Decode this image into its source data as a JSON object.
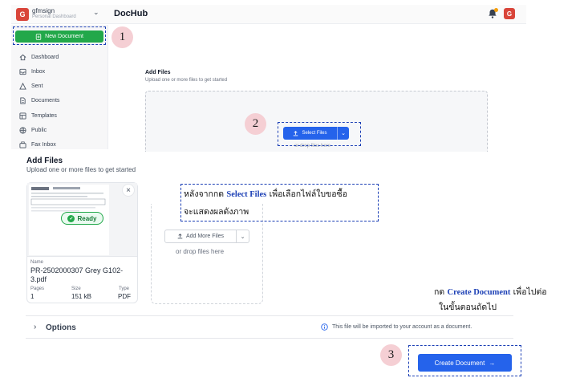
{
  "header": {
    "workspace_initial": "G",
    "workspace_name": "gfmsign",
    "workspace_subtitle": "Personal Dashboard",
    "app_title": "DocHub",
    "user_initial": "G"
  },
  "sidebar": {
    "new_document_label": "New Document",
    "items": [
      {
        "label": "Dashboard",
        "icon": "home-icon"
      },
      {
        "label": "Inbox",
        "icon": "inbox-icon"
      },
      {
        "label": "Sent",
        "icon": "send-icon"
      },
      {
        "label": "Documents",
        "icon": "document-icon"
      },
      {
        "label": "Templates",
        "icon": "template-icon"
      },
      {
        "label": "Public",
        "icon": "globe-icon"
      },
      {
        "label": "Fax Inbox",
        "icon": "fax-icon"
      }
    ]
  },
  "upload_top": {
    "title": "Add Files",
    "subtitle": "Upload one or more files to get started",
    "select_files_label": "Select Files",
    "drop_text": "or drop files here"
  },
  "upload_bottom": {
    "title": "Add Files",
    "subtitle": "Upload one or more files to get started",
    "file": {
      "status": "Ready",
      "name_label": "Name",
      "name": "PR-2502000307 Grey G102-3.pdf",
      "pages_label": "Pages",
      "pages": "1",
      "size_label": "Size",
      "size": "151 kB",
      "type_label": "Type",
      "type": "PDF"
    },
    "add_more_label": "Add More Files",
    "drop_text": "or drop files here",
    "options_label": "Options",
    "import_note": "This file will be imported to your account as a document.",
    "create_document_label": "Create Document"
  },
  "annotations": {
    "step1": "1",
    "step2": "2",
    "step3": "3",
    "note2_prefix": "หลังจากกด ",
    "note2_highlight": "Select Files",
    "note2_suffix": " เพื่อเลือกไฟล์ใบขอซื้อ",
    "note2_line2": "จะแสดงผลดังภาพ",
    "note3_prefix": "กด ",
    "note3_highlight": "Create Document",
    "note3_suffix": " เพื่อไปต่อ",
    "note3_line2": "ในขั้นตอนถัดไป"
  },
  "colors": {
    "brand_red": "#d9453a",
    "new_doc_green": "#22a84a",
    "primary_blue": "#2563eb",
    "annotation_blue": "#1b3fb5",
    "step_circle_pink": "#f5cfd4"
  }
}
